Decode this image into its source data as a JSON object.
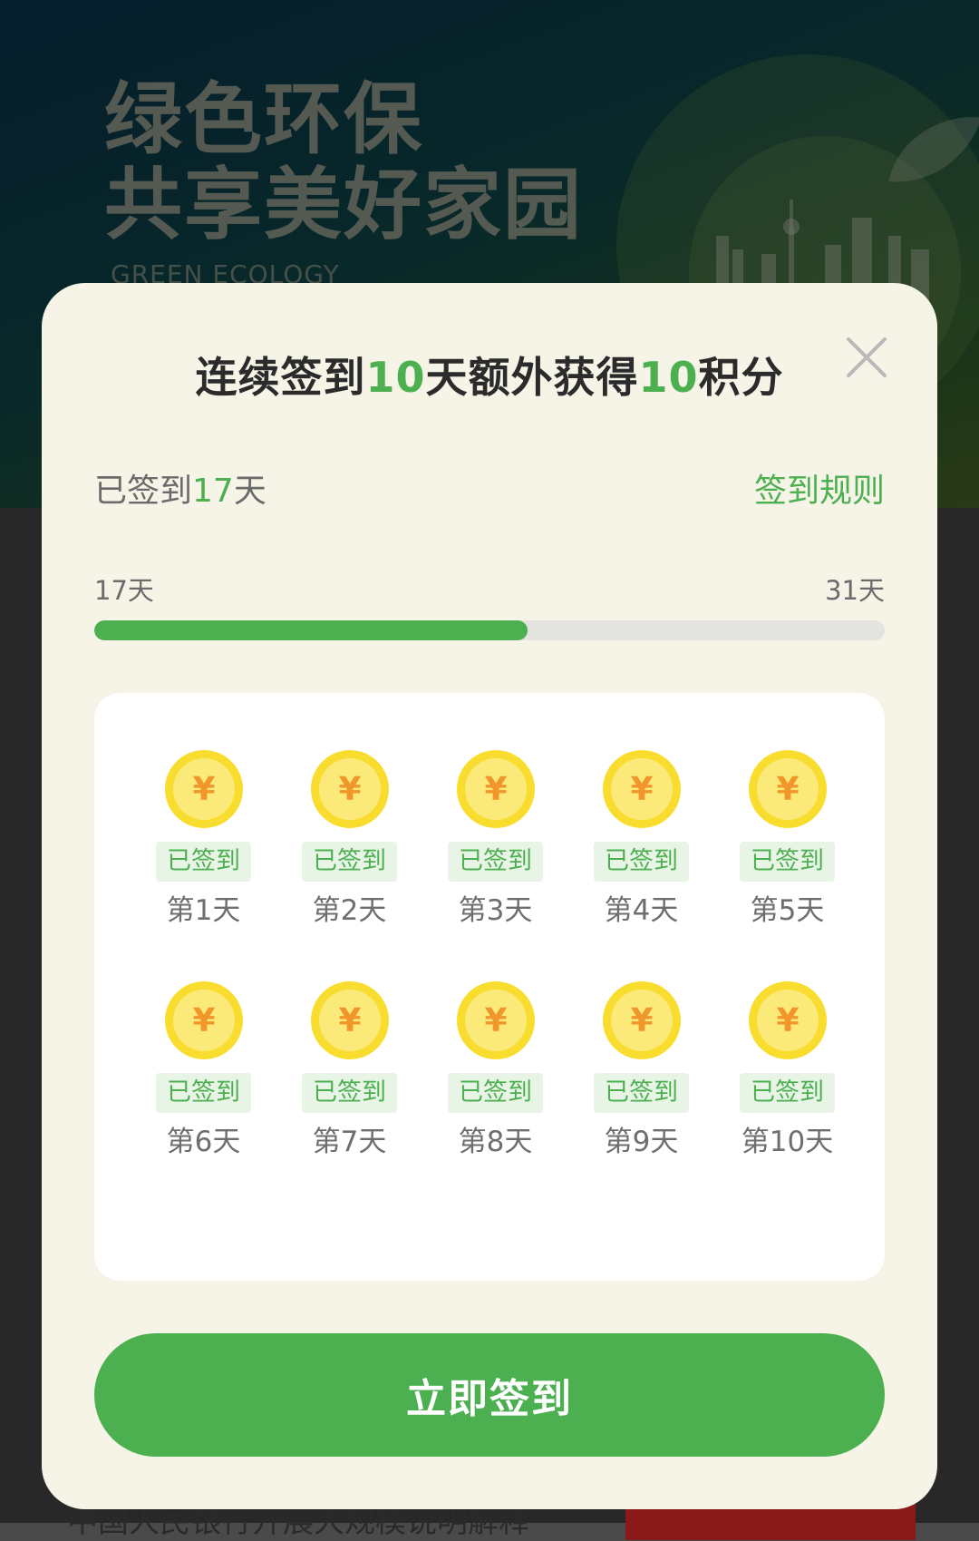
{
  "banner": {
    "title_line1": "绿色环保",
    "title_line2": "共享美好家园",
    "subtitle": "GREEN ECOLOGY"
  },
  "background_peek_text": "中国人民银行开展大规模说明解释",
  "modal": {
    "title_prefix": "连续签到",
    "title_days": "10",
    "title_mid": "天额外获得",
    "title_points": "10",
    "title_suffix": "积分",
    "signed_prefix": "已签到",
    "signed_days": "17",
    "signed_suffix": "天",
    "rules_link": "签到规则",
    "progress": {
      "start_label": "17天",
      "end_label": "31天",
      "value": 17,
      "max": 31
    },
    "days": [
      {
        "status": "已签到",
        "label": "第1天"
      },
      {
        "status": "已签到",
        "label": "第2天"
      },
      {
        "status": "已签到",
        "label": "第3天"
      },
      {
        "status": "已签到",
        "label": "第4天"
      },
      {
        "status": "已签到",
        "label": "第5天"
      },
      {
        "status": "已签到",
        "label": "第6天"
      },
      {
        "status": "已签到",
        "label": "第7天"
      },
      {
        "status": "已签到",
        "label": "第8天"
      },
      {
        "status": "已签到",
        "label": "第9天"
      },
      {
        "status": "已签到",
        "label": "第10天"
      }
    ],
    "coin_symbol": "¥",
    "signin_button": "立即签到"
  },
  "colors": {
    "accent": "#4caf50",
    "modal_bg": "#f6f3e7",
    "coin": "#f7d83a"
  },
  "icons": {
    "close": "close-icon",
    "coin": "yuan-coin-icon"
  }
}
